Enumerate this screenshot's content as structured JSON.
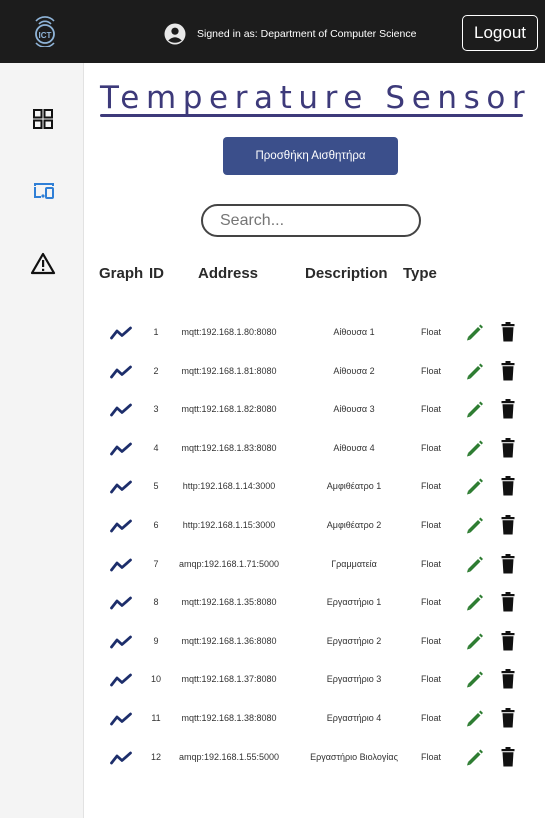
{
  "header": {
    "signed_in_text": "Signed in as: Department of Computer Science",
    "logout_label": "Logout"
  },
  "sidebar": {
    "items": [
      {
        "icon": "grid-icon"
      },
      {
        "icon": "devices-icon"
      },
      {
        "icon": "warning-icon"
      }
    ],
    "active_color": "#2f7fd6"
  },
  "page": {
    "title": "Temperature Sensor",
    "add_button_label": "Προσθήκη Αισθητήρα",
    "search_placeholder": "Search..."
  },
  "table": {
    "headers": [
      "Graph",
      "ID",
      "Address",
      "Description",
      "Type"
    ],
    "rows": [
      {
        "id": "1",
        "address": "mqtt:192.168.1.80:8080",
        "description": "Αίθουσα 1",
        "type": "Float"
      },
      {
        "id": "2",
        "address": "mqtt:192.168.1.81:8080",
        "description": "Αίθουσα 2",
        "type": "Float"
      },
      {
        "id": "3",
        "address": "mqtt:192.168.1.82:8080",
        "description": "Αίθουσα 3",
        "type": "Float"
      },
      {
        "id": "4",
        "address": "mqtt:192.168.1.83:8080",
        "description": "Αίθουσα 4",
        "type": "Float"
      },
      {
        "id": "5",
        "address": "http:192.168.1.14:3000",
        "description": "Αμφιθέατρο 1",
        "type": "Float"
      },
      {
        "id": "6",
        "address": "http:192.168.1.15:3000",
        "description": "Αμφιθέατρο 2",
        "type": "Float"
      },
      {
        "id": "7",
        "address": "amqp:192.168.1.71:5000",
        "description": "Γραμματεία",
        "type": "Float"
      },
      {
        "id": "8",
        "address": "mqtt:192.168.1.35:8080",
        "description": "Εργαστήριο 1",
        "type": "Float"
      },
      {
        "id": "9",
        "address": "mqtt:192.168.1.36:8080",
        "description": "Εργαστήριο 2",
        "type": "Float"
      },
      {
        "id": "10",
        "address": "mqtt:192.168.1.37:8080",
        "description": "Εργαστήριο 3",
        "type": "Float"
      },
      {
        "id": "11",
        "address": "mqtt:192.168.1.38:8080",
        "description": "Εργαστήριο 4",
        "type": "Float"
      },
      {
        "id": "12",
        "address": "amqp:192.168.1.55:5000",
        "description": "Εργαστήριο Βιολογίας",
        "type": "Float"
      }
    ]
  },
  "colors": {
    "graph_icon": "#1d2e6b",
    "edit_icon": "#2e7d32",
    "delete_icon": "#111111",
    "title": "#3d3a7a",
    "add_button": "#3b4f8b"
  }
}
